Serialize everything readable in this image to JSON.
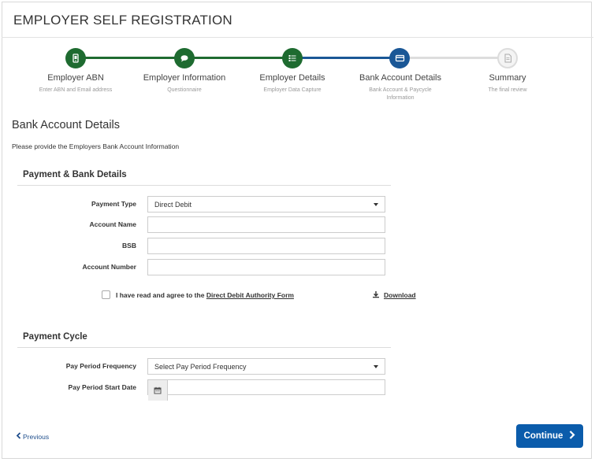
{
  "header": {
    "title": "EMPLOYER SELF REGISTRATION"
  },
  "colors": {
    "complete": "#1e6b30",
    "current": "#1a5796",
    "pending": "#dddddd",
    "primary_button": "#0b5cab",
    "link": "#1f4e8c"
  },
  "steps": [
    {
      "label": "Employer ABN",
      "sub": "Enter ABN and Email address",
      "icon": "mobile-icon",
      "state": "complete"
    },
    {
      "label": "Employer Information",
      "sub": "Questionnaire",
      "icon": "chat-bubble-icon",
      "state": "complete"
    },
    {
      "label": "Employer Details",
      "sub": "Employer Data Capture",
      "icon": "list-icon",
      "state": "complete"
    },
    {
      "label": "Bank Account Details",
      "sub": "Bank Account & Paycycle Information",
      "icon": "credit-card-icon",
      "state": "current"
    },
    {
      "label": "Summary",
      "sub": "The final review",
      "icon": "document-icon",
      "state": "pending"
    }
  ],
  "page": {
    "heading": "Bank Account Details",
    "description": "Please provide the Employers Bank Account Information"
  },
  "bank": {
    "title": "Payment & Bank Details",
    "payment_type_label": "Payment Type",
    "payment_type_value": "Direct Debit",
    "account_name_label": "Account Name",
    "account_name_value": "",
    "bsb_label": "BSB",
    "bsb_value": "",
    "account_number_label": "Account Number",
    "account_number_value": "",
    "agree_prefix": "I have read and agree to the",
    "agree_link": "Direct Debit Authority Form",
    "download_label": "Download"
  },
  "cycle": {
    "title": "Payment Cycle",
    "frequency_label": "Pay Period Frequency",
    "frequency_value": "Select Pay Period Frequency",
    "start_date_label": "Pay Period Start Date",
    "start_date_value": ""
  },
  "nav": {
    "previous": "Previous",
    "continue": "Continue"
  }
}
